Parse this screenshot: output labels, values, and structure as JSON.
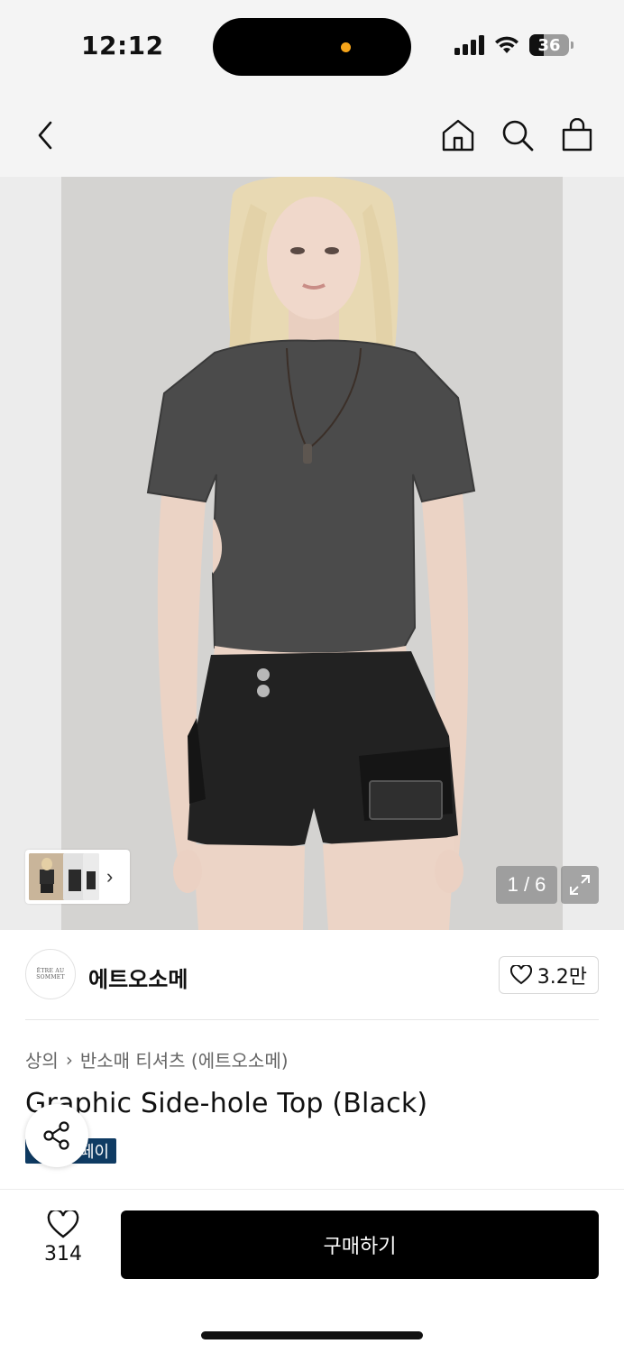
{
  "status_bar": {
    "time": "12:12",
    "battery": "36"
  },
  "icons": {
    "back": "chevron-left-icon",
    "home": "home-icon",
    "search": "search-icon",
    "cart": "shopping-bag-icon",
    "expand": "expand-icon",
    "heart": "heart-icon",
    "share": "share-icon"
  },
  "gallery": {
    "counter": "1 / 6",
    "thumb_arrow": "›"
  },
  "brand": {
    "logo_text": "ÊTRE AU SOMMET",
    "name": "에트오소메",
    "likes": "3.2만"
  },
  "breadcrumb": {
    "level1": "상의",
    "separator": "›",
    "level2": "반소매 티셔츠 (에트오소메)"
  },
  "product": {
    "title": "Graphic Side-hole Top (Black)",
    "badge": "페이"
  },
  "bottom_bar": {
    "wish_count": "314",
    "buy_label": "구매하기"
  },
  "colors": {
    "badge_bg": "#0f3b63",
    "buy_bg": "#000000",
    "island_dot": "#f6a51a"
  }
}
